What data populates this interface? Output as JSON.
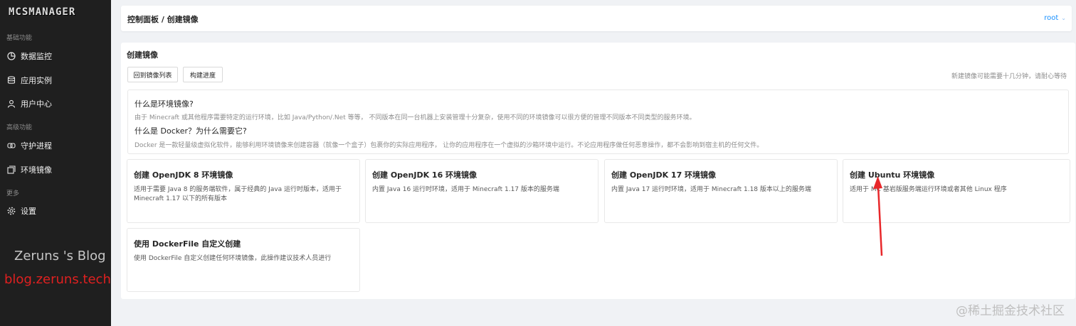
{
  "sidebar": {
    "logo": "MCSMANAGER",
    "sections": {
      "basic": "基础功能",
      "advanced": "高级功能",
      "more": "更多"
    },
    "items": [
      {
        "label": "数据监控",
        "icon": "chart-pie-icon"
      },
      {
        "label": "应用实例",
        "icon": "database-icon"
      },
      {
        "label": "用户中心",
        "icon": "user-icon"
      },
      {
        "label": "守护进程",
        "icon": "link-icon"
      },
      {
        "label": "环境镜像",
        "icon": "layers-icon"
      },
      {
        "label": "设置",
        "icon": "gear-icon"
      }
    ]
  },
  "watermark": {
    "blog_name": "Zeruns 's Blog",
    "blog_url": "blog.zeruns.tech",
    "platform": "@稀土掘金技术社区"
  },
  "header": {
    "breadcrumb": "控制面板 / 创建镜像",
    "user": "root"
  },
  "main": {
    "title": "创建镜像",
    "buttons": {
      "back": "回到镜像列表",
      "progress": "构建进度"
    },
    "hint": "新建镜像可能需要十几分钟，请耐心等待",
    "info": {
      "q1": "什么是环境镜像?",
      "a1": "由于 Minecraft 或其他程序需要特定的运行环境，比如 Java/Python/.Net 等等， 不同版本在同一台机器上安装管理十分复杂，使用不同的环境镜像可以很方便的管理不同版本不同类型的服务环境。",
      "q2": "什么是 Docker？为什么需要它?",
      "a2": "Docker 是一款轻量级虚拟化软件，能够利用环境镜像来创建容器（就像一个盒子）包裹你的实际应用程序， 让你的应用程序在一个虚拟的沙箱环境中运行。不论应用程序做任何恶意操作，都不会影响到宿主机的任何文件。"
    },
    "cards": [
      {
        "title": "创建 OpenJDK 8 环境镜像",
        "desc": "适用于需要 Java 8 的服务端软件，属于经典的 Java 运行时版本，适用于 Minecraft 1.17 以下的所有版本"
      },
      {
        "title": "创建 OpenJDK 16 环境镜像",
        "desc": "内置 Java 16 运行时环境，适用于 Minecraft 1.17 版本的服务端"
      },
      {
        "title": "创建 OpenJDK 17 环境镜像",
        "desc": "内置 Java 17 运行时环境，适用于 Minecraft 1.18 版本以上的服务端"
      },
      {
        "title": "创建 Ubuntu 环境镜像",
        "desc": "适用于 MC 基岩版服务端运行环境或者其他 Linux 程序"
      },
      {
        "title": "使用 DockerFile 自定义创建",
        "desc": "使用 DockerFile 自定义创建任何环境镜像，此操作建议技术人员进行"
      }
    ]
  },
  "colors": {
    "accent": "#1890ff",
    "annotation_arrow": "#e8282b",
    "sidebar_bg": "#1f1f1f"
  }
}
